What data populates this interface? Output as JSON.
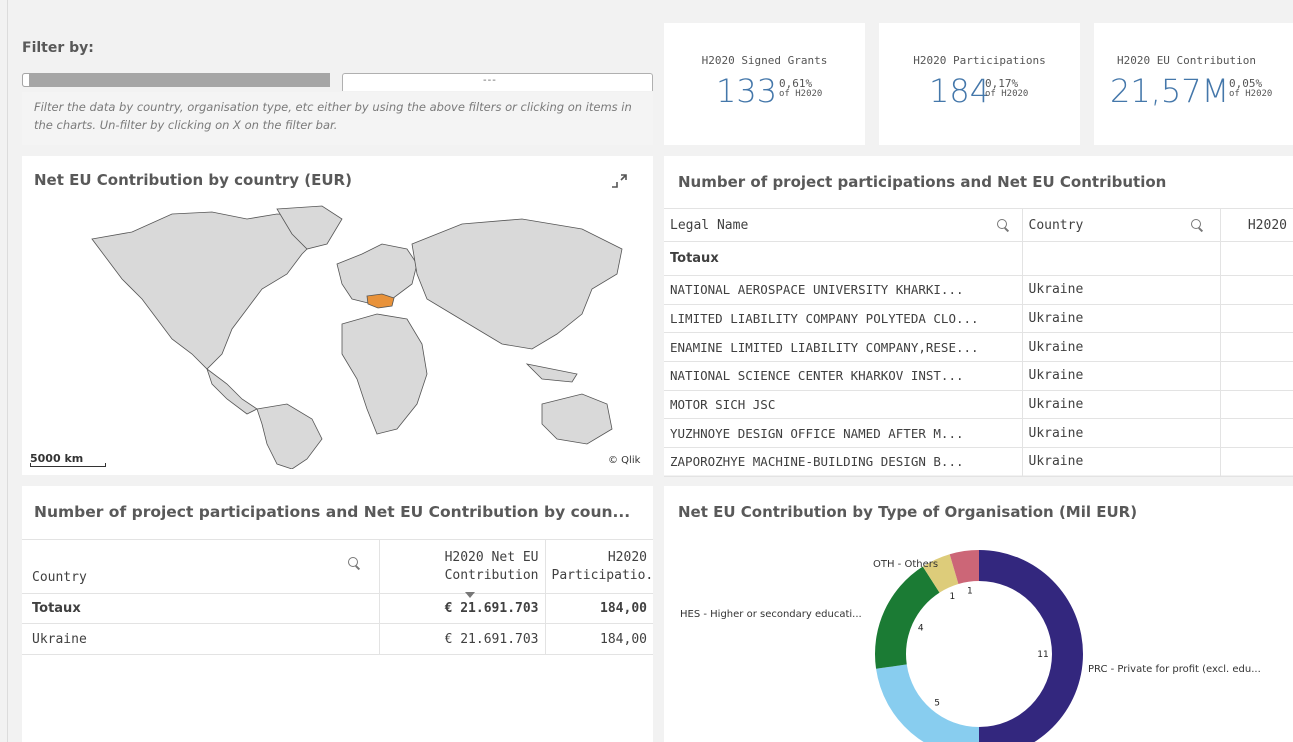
{
  "filter": {
    "title": "Filter by:",
    "box_text": "---",
    "help": "Filter the data by country, organisation type, etc either by using the above filters or clicking on items in the charts. Un-filter by clicking on X on the filter bar."
  },
  "kpis": [
    {
      "label": "H2020 Signed Grants",
      "value": "133",
      "pct": "0,61%",
      "of": "of H2020"
    },
    {
      "label": "H2020 Participations",
      "value": "184",
      "pct": "0,17%",
      "of": "of H2020"
    },
    {
      "label": "H2020 EU Contribution",
      "value": "21,57M",
      "pct": "0,05%",
      "of": "of H2020"
    }
  ],
  "map": {
    "title": "Net EU Contribution by country (EUR)",
    "scale": "5000 km",
    "credit": "© Qlik",
    "highlight_color": "#e8923a"
  },
  "participations": {
    "title": "Number of project participations and Net EU Contribution",
    "headers": {
      "legal_name": "Legal Name",
      "country": "Country",
      "h2020": "H2020"
    },
    "totals_label": "Totaux",
    "rows": [
      {
        "name": "NATIONAL AEROSPACE UNIVERSITY KHARKI...",
        "country": "Ukraine"
      },
      {
        "name": "LIMITED LIABILITY COMPANY POLYTEDA CLO...",
        "country": "Ukraine"
      },
      {
        "name": "ENAMINE LIMITED LIABILITY COMPANY,RESE...",
        "country": "Ukraine"
      },
      {
        "name": "NATIONAL SCIENCE CENTER KHARKOV INST...",
        "country": "Ukraine"
      },
      {
        "name": "MOTOR SICH JSC",
        "country": "Ukraine"
      },
      {
        "name": "YUZHNOYE DESIGN OFFICE NAMED AFTER M...",
        "country": "Ukraine"
      },
      {
        "name": "ZAPOROZHYE MACHINE-BUILDING DESIGN B...",
        "country": "Ukraine"
      }
    ]
  },
  "country_table": {
    "title": "Number of project participations and Net EU Contribution by coun...",
    "headers": {
      "country": "Country",
      "net": "H2020 Net EU Contribution",
      "net_l1": "H2020 Net EU",
      "net_l2": "Contribution",
      "part_l1": "H2020",
      "part_l2": "Participatio.."
    },
    "totals": {
      "label": "Totaux",
      "net": "€ 21.691.703",
      "part": "184,00"
    },
    "rows": [
      {
        "country": "Ukraine",
        "net": "€ 21.691.703",
        "part": "184,00"
      }
    ]
  },
  "org_chart": {
    "title": "Net EU Contribution by Type of Organisation (Mil EUR)",
    "labels": {
      "oth": "OTH - Others",
      "hes": "HES - Higher or secondary educati...",
      "prc": "PRC - Private for profit (excl. edu..."
    }
  },
  "chart_data": {
    "type": "pie",
    "title": "Net EU Contribution by Type of Organisation (Mil EUR)",
    "series": [
      {
        "name": "PRC - Private for profit (excl. edu...",
        "value": 11,
        "color": "#33277e"
      },
      {
        "name": "",
        "value": 5,
        "color": "#88cdef"
      },
      {
        "name": "HES - Higher or secondary educati...",
        "value": 4,
        "color": "#1b7b34"
      },
      {
        "name": "OTH - Others",
        "value": 1,
        "color": "#ddcc7a"
      },
      {
        "name": "",
        "value": 1,
        "color": "#cc6677"
      }
    ]
  }
}
